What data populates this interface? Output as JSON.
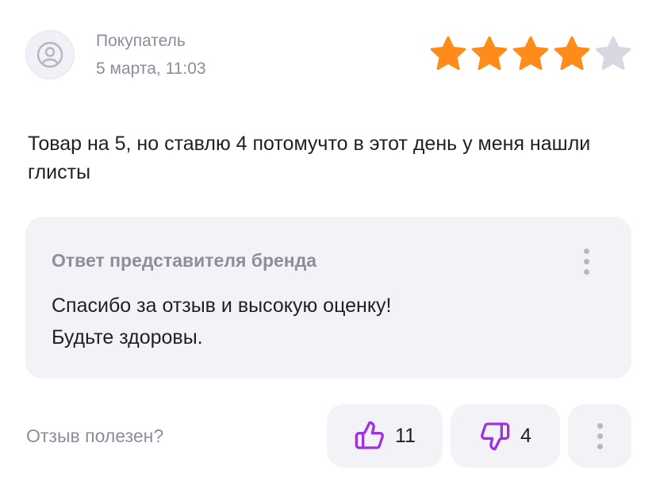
{
  "review": {
    "author": "Покупатель",
    "date": "5 марта, 11:03",
    "rating": 4,
    "rating_max": 5,
    "text": "Товар на 5, но ставлю 4 потомучто в этот день у меня нашли глисты",
    "avatar_icon": "user-icon"
  },
  "reply": {
    "title": "Ответ представителя бренда",
    "lines": [
      "Спасибо за отзыв и высокую оценку!",
      "Будьте здоровы."
    ]
  },
  "footer": {
    "helpful_label": "Отзыв полезен?",
    "likes": "11",
    "dislikes": "4",
    "like_icon": "thumbs-up-icon",
    "dislike_icon": "thumbs-down-icon"
  },
  "colors": {
    "star_filled": "#ff8c1a",
    "star_empty": "#d8d7e2",
    "accent_purple": "#a033e0",
    "muted_text": "#8d8d9b",
    "panel_bg": "#f3f2f7"
  }
}
